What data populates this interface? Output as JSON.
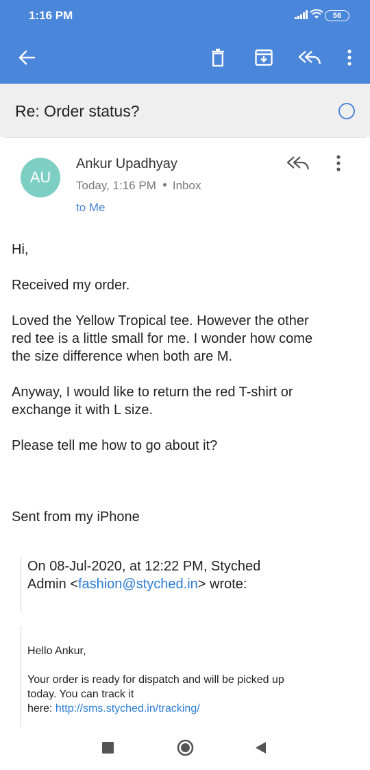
{
  "status_bar": {
    "time": "1:16 PM",
    "battery": "56"
  },
  "subject": "Re: Order status?",
  "message": {
    "avatar_initials": "AU",
    "sender": "Ankur Upadhyay",
    "time": "Today, 1:16 PM",
    "folder": "Inbox",
    "recipients": "to Me",
    "greeting": "Hi,",
    "para1": "Received my order.",
    "para2_line1": "Loved the Yellow Tropical tee. However the other",
    "para2_line2": "red tee is a little small for me. I wonder how come",
    "para2_line3": "the size difference when both are M.",
    "para3_line1": "Anyway, I would like to return the red T-shirt or",
    "para3_line2": "exchange it with L size.",
    "para4": "Please tell me how to go about it?",
    "signature": "Sent from my iPhone",
    "quote_header_line1": "On 08-Jul-2020, at 12:22 PM, Styched",
    "quote_header_prefix": "Admin <",
    "quote_email": "fashion@styched.in",
    "quote_header_suffix": "> wrote:",
    "quote_greeting": "Hello Ankur,",
    "quote_line1": "Your order is ready for dispatch and will be picked up",
    "quote_line2": "today. You can track it",
    "quote_line3_prefix": "here: ",
    "quote_link": "http://sms.styched.in/tracking/"
  },
  "icons": {
    "back": "arrow-left-icon",
    "delete": "trash-icon",
    "archive": "archive-icon",
    "reply_all": "reply-all-icon",
    "more": "more-vertical-icon"
  },
  "colors": {
    "accent": "#4a86d9",
    "avatar": "#7ecfc3",
    "link": "#2a7bd4"
  }
}
